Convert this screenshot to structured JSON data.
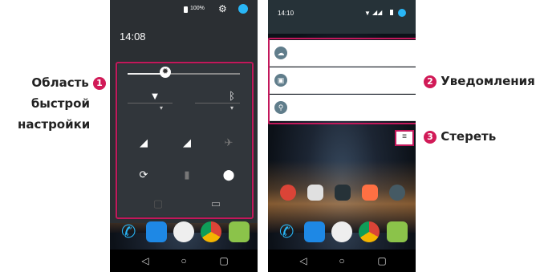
{
  "callouts": {
    "quick_settings": {
      "line1": "Область",
      "line2": "быстрой",
      "line3": "настройки",
      "number": "1"
    },
    "notifications": {
      "label": "Уведомления",
      "number": "2"
    },
    "clear": {
      "label": "Стереть",
      "number": "3"
    }
  },
  "left_phone": {
    "battery": "100%",
    "time": "14:08"
  },
  "right_phone": {
    "time": "14:10"
  },
  "colors": {
    "accent": "#c2185b",
    "badge": "#d11a57",
    "shade": "#2b2f33"
  }
}
